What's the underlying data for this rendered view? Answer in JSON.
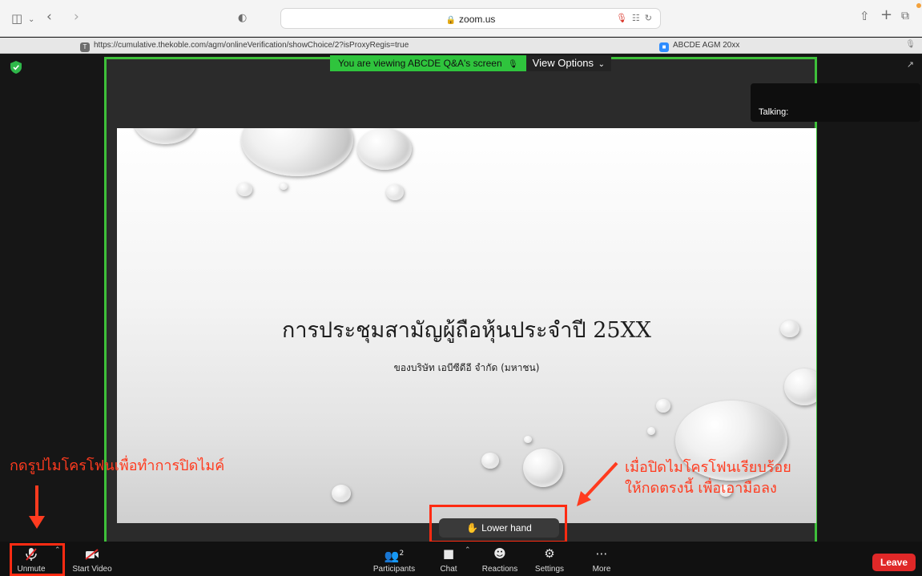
{
  "browser": {
    "address": "zoom.us",
    "tabs": [
      {
        "title": "https://cumulative.thekoble.com/agm/onlineVerification/showChoice/2?isProxyRegis=true"
      },
      {
        "title": "ABCDE AGM 20xx"
      }
    ]
  },
  "zoom": {
    "banner_text": "You are viewing ABCDE Q&A's screen",
    "view_options": "View Options",
    "talking": "Talking:",
    "slide_title": "การประชุมสามัญผู้ถือหุ้นประจำปี 25XX",
    "slide_subtitle": "ของบริษัท เอบีซีดีอี จำกัด (มหาชน)",
    "lower_hand": "Lower hand",
    "participants_count": "2",
    "toolbar": {
      "unmute": "Unmute",
      "start_video": "Start Video",
      "participants": "Participants",
      "chat": "Chat",
      "reactions": "Reactions",
      "settings": "Settings",
      "more": "More",
      "leave": "Leave"
    }
  },
  "annotations": {
    "left": "กดรูปไมโครโฟนเพื่อทำการปิดไมค์",
    "right_line1": "เมื่อปิดไมโครโฟนเรียบร้อย",
    "right_line2": "ให้กดตรงนี้ เพื่อเอามือลง"
  },
  "colors": {
    "annotation_red": "#ff2b12",
    "share_border_green": "#3ec03a",
    "leave_red": "#e02828"
  }
}
